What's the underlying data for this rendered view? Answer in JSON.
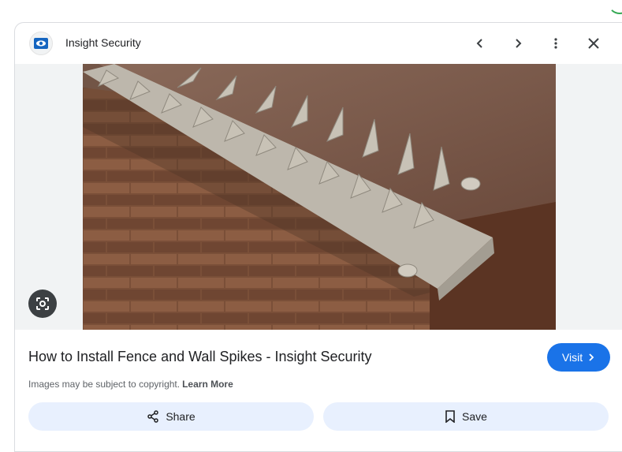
{
  "header": {
    "site_name": "Insight Security",
    "prev_icon": "chevron-left-icon",
    "next_icon": "chevron-right-icon",
    "more_icon": "more-vert-icon",
    "close_icon": "close-icon"
  },
  "image": {
    "lens_icon": "lens-icon"
  },
  "result": {
    "title": "How to Install Fence and Wall Spikes - Insight Security",
    "visit_label": "Visit",
    "copyright_text": "Images may be subject to copyright.",
    "learn_more_label": "Learn More"
  },
  "actions": {
    "share_label": "Share",
    "save_label": "Save"
  },
  "colors": {
    "accent": "#1a73e8",
    "action_bg": "#e8f0fe",
    "brick": "#8a5f45",
    "spike": "#bdb7ac"
  }
}
